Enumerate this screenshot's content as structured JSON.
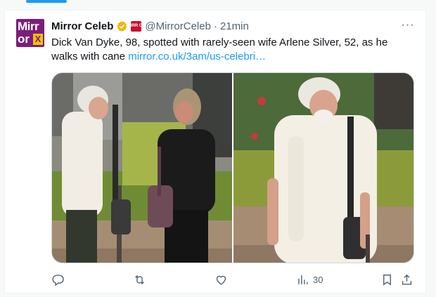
{
  "account": {
    "display_name": "Mirror Celeb",
    "handle": "@MirrorCeleb",
    "separator": "·",
    "time": "21min",
    "avatar_text_top": "Mirr",
    "avatar_text_bottom": "or",
    "avatar_text_x": "X",
    "org_badge_text": "MIRR OR"
  },
  "tweet": {
    "text": "Dick Van Dyke, 98, spotted with rarely-seen wife Arlene Silver, 52, as he walks with cane ",
    "link": "mirror.co.uk/3am/us-celebri…"
  },
  "actions": {
    "views_count": "30",
    "more_label": "···"
  },
  "icons": {
    "verified": "verified-badge-icon",
    "reply": "reply-icon",
    "retweet": "retweet-icon",
    "like": "heart-icon",
    "views": "analytics-icon",
    "bookmark": "bookmark-icon",
    "share": "share-icon"
  },
  "colors": {
    "link": "#1d9bf0",
    "muted": "#536471",
    "verified": "#f4b400",
    "brand": "#7b1e7a"
  }
}
